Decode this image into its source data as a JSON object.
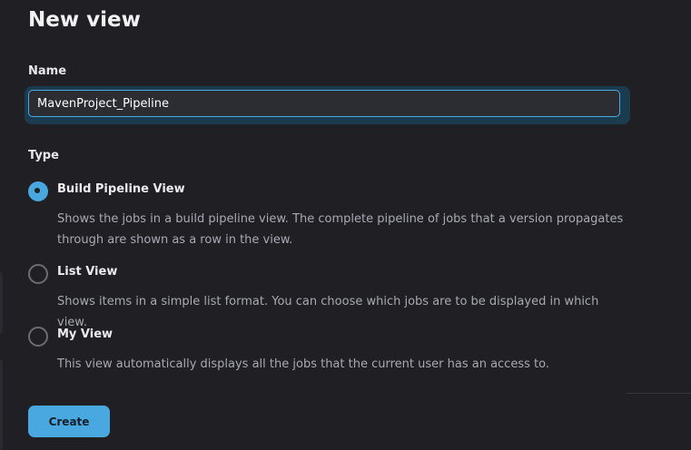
{
  "page": {
    "title": "New view"
  },
  "form": {
    "name_label": "Name",
    "name_value": "MavenProject_Pipeline",
    "type_label": "Type",
    "options": [
      {
        "label": "Build Pipeline View",
        "description": "Shows the jobs in a build pipeline view. The complete pipeline of jobs that a version propagates through are shown as a row in the view.",
        "selected": true
      },
      {
        "label": "List View",
        "description": "Shows items in a simple list format. You can choose which jobs are to be displayed in which view.",
        "selected": false
      },
      {
        "label": "My View",
        "description": "This view automatically displays all the jobs that the current user has an access to.",
        "selected": false
      }
    ],
    "create_label": "Create"
  },
  "colors": {
    "accent": "#4aa8e0",
    "background": "#1f1f24",
    "input_background": "#2c2c33"
  }
}
